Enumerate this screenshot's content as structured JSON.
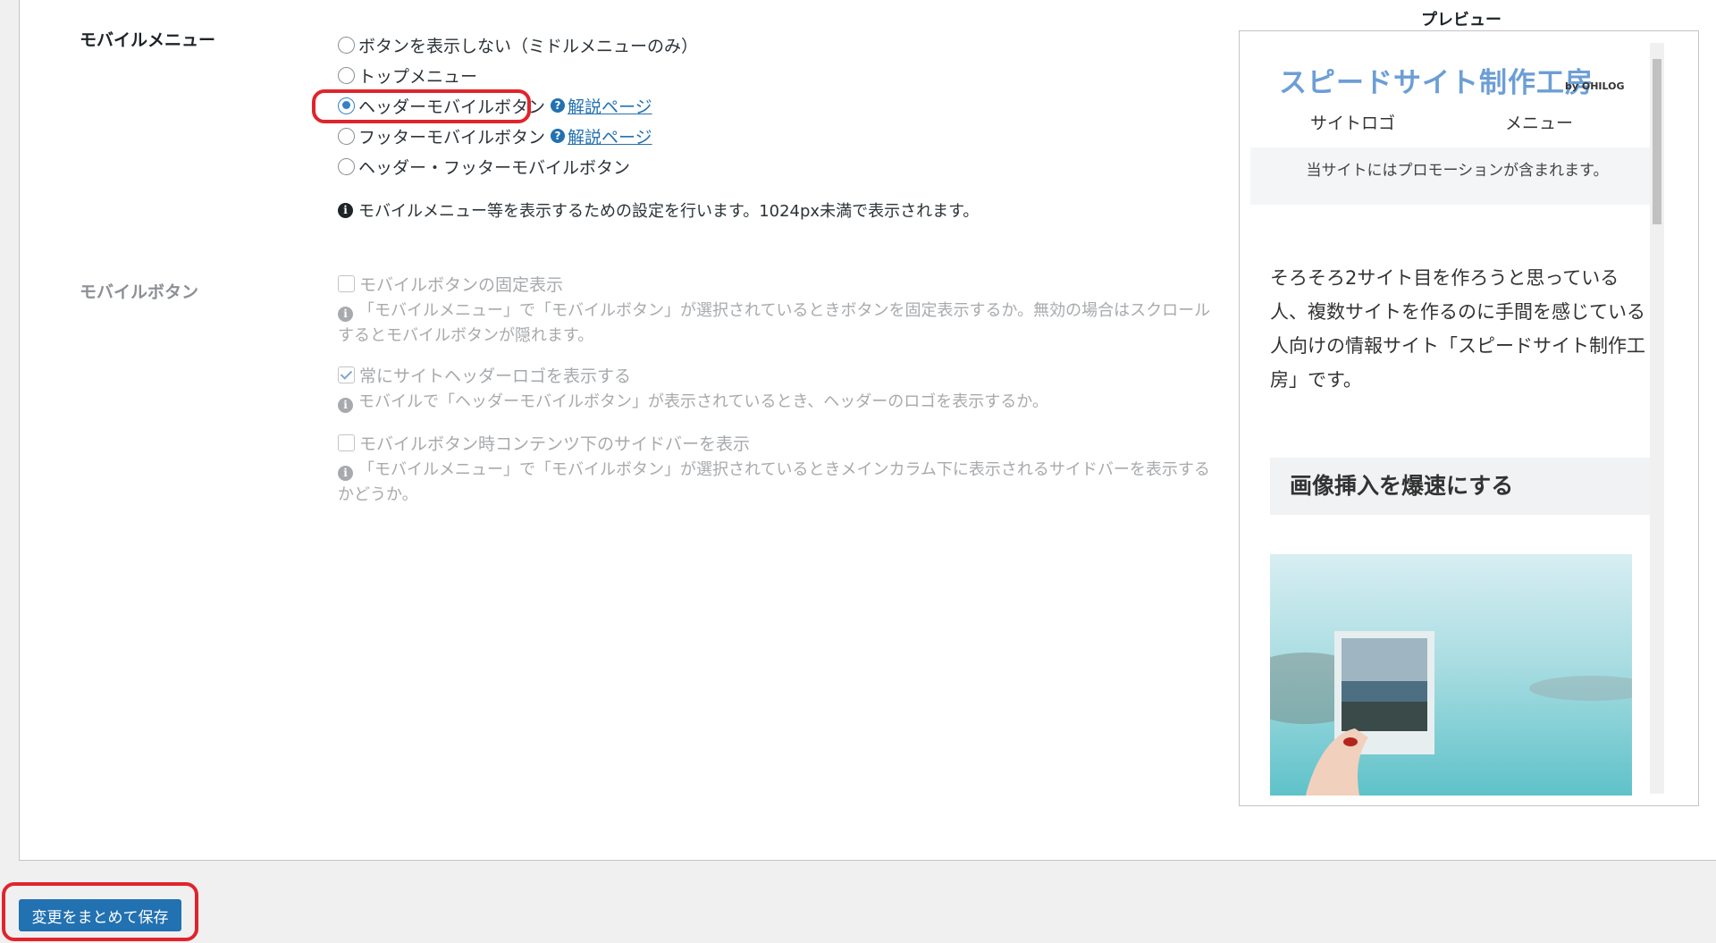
{
  "mobile_menu": {
    "label": "モバイルメニュー",
    "options": [
      {
        "label": "ボタンを表示しない（ミドルメニューのみ）",
        "checked": false
      },
      {
        "label": "トップメニュー",
        "checked": false
      },
      {
        "label": "ヘッダーモバイルボタン",
        "checked": true,
        "help_link": "解説ページ"
      },
      {
        "label": "フッターモバイルボタン",
        "checked": false,
        "help_link": "解説ページ"
      },
      {
        "label": "ヘッダー・フッターモバイルボタン",
        "checked": false
      }
    ],
    "note": "モバイルメニュー等を表示するための設定を行います。1024px未満で表示されます。"
  },
  "mobile_button": {
    "label": "モバイルボタン",
    "fixed_display": {
      "label": "モバイルボタンの固定表示",
      "checked": false,
      "desc": "「モバイルメニュー」で「モバイルボタン」が選択されているときボタンを固定表示するか。無効の場合はスクロールするとモバイルボタンが隠れます。"
    },
    "always_logo": {
      "label": "常にサイトヘッダーロゴを表示する",
      "checked": true,
      "desc": "モバイルで「ヘッダーモバイルボタン」が表示されているとき、ヘッダーのロゴを表示するか。"
    },
    "sidebar_below": {
      "label": "モバイルボタン時コンテンツ下のサイドバーを表示",
      "checked": false,
      "desc": "「モバイルメニュー」で「モバイルボタン」が選択されているときメインカラム下に表示されるサイドバーを表示するかどうか。"
    }
  },
  "preview": {
    "title": "プレビュー",
    "site_logo": "スピードサイト制作工房",
    "logo_by": "by OHILOG",
    "nav_logo": "サイトロゴ",
    "nav_menu": "メニュー",
    "promo": "当サイトにはプロモーションが含まれます。",
    "body_text": "そろそろ2サイト目を作ろうと思っている人、複数サイトを作るのに手間を感じている人向けの情報サイト「スピードサイト制作工房」です。",
    "heading": "画像挿入を爆速にする"
  },
  "save_button": "変更をまとめて保存",
  "colors": {
    "accent": "#2271b1",
    "highlight_ring": "#e0242b",
    "logo": "#6c9ed6"
  },
  "icons": {
    "help": "question-circle-icon",
    "info": "info-circle-icon"
  }
}
